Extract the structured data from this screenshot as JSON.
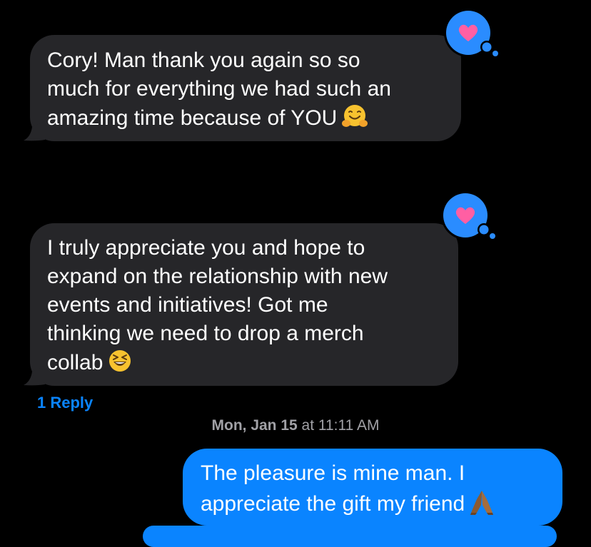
{
  "conversation": {
    "messages": [
      {
        "direction": "incoming",
        "lines": [
          "Cory! Man thank you again so so",
          "much for everything we had such an",
          "amazing time because of YOU"
        ],
        "emoji": "hugging-face",
        "tapback": "heart"
      },
      {
        "direction": "incoming",
        "lines": [
          "I truly appreciate you and hope to",
          "expand on the relationship with new",
          "events and initiatives! Got me",
          "thinking we need to drop a merch",
          "collab"
        ],
        "emoji": "grinning-squinting-face",
        "tapback": "heart"
      }
    ],
    "reply_link": "1 Reply",
    "timestamp": {
      "day": "Mon, Jan 15",
      "time": " at 11:11 AM"
    },
    "outgoing": {
      "lines": [
        "The pleasure is mine man. I",
        "appreciate the gift my friend"
      ],
      "emoji": "folded-hands"
    }
  },
  "colors": {
    "background": "#000000",
    "incoming_bubble": "#262629",
    "outgoing_bubble": "#0a84ff",
    "tapback_badge": "#2a8cff",
    "heart": "#ff5fa3",
    "timestamp_text": "#a1a1a6"
  }
}
